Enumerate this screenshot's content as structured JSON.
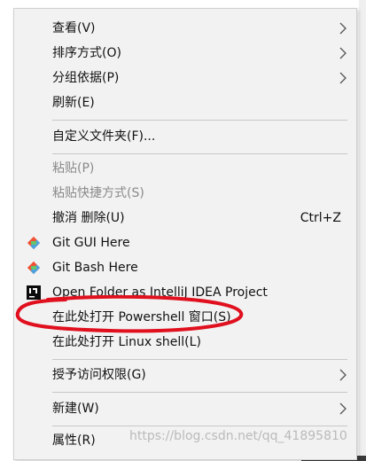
{
  "context_menu": {
    "items": [
      {
        "label": "查看(V)"
      },
      {
        "label": "排序方式(O)"
      },
      {
        "label": "分组依据(P)"
      },
      {
        "label": "刷新(E)"
      },
      {
        "label": "自定义文件夹(F)..."
      },
      {
        "label": "粘贴(P)"
      },
      {
        "label": "粘贴快捷方式(S)"
      },
      {
        "label": "撤消 删除(U)",
        "shortcut": "Ctrl+Z"
      },
      {
        "label": "Git GUI Here",
        "icon": "git-icon"
      },
      {
        "label": "Git Bash Here",
        "icon": "git-icon"
      },
      {
        "label": "Open Folder as IntelliJ IDEA Project",
        "icon": "intellij-idea-icon"
      },
      {
        "label": "在此处打开 Powershell 窗口(S)"
      },
      {
        "label": "在此处打开 Linux shell(L)"
      },
      {
        "label": "授予访问权限(G)"
      },
      {
        "label": "新建(W)"
      },
      {
        "label": "属性(R)"
      }
    ]
  },
  "watermark": "https://blog.csdn.net/qq_41895810",
  "colors": {
    "menu_bg": "#f2f2f2",
    "text": "#111111",
    "disabled_text": "#8a8a8a",
    "annotation_red": "#e0101e",
    "git_orange": "#f05033",
    "git_blue": "#4aa3df"
  }
}
